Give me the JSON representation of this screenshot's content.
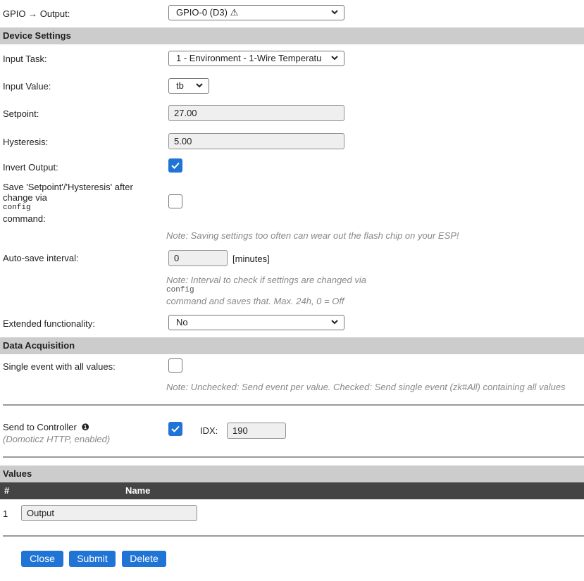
{
  "gpio": {
    "label": "GPIO → Output:",
    "value": "GPIO-0 (D3) ⚠"
  },
  "device_settings": {
    "header": "Device Settings",
    "input_task": {
      "label": "Input Task:",
      "value": "1 - Environment - 1-Wire Temperatu"
    },
    "input_value": {
      "label": "Input Value:",
      "value": "tb"
    },
    "setpoint": {
      "label": "Setpoint:",
      "value": "27.00"
    },
    "hysteresis": {
      "label": "Hysteresis:",
      "value": "5.00"
    },
    "invert_output": {
      "label": "Invert Output:",
      "checked": true
    },
    "save_after_change": {
      "label_line1": "Save 'Setpoint'/'Hysteresis' after",
      "label_line2": "change via",
      "label_code": "config",
      "label_line3": "command:",
      "checked": false,
      "note": "Note: Saving settings too often can wear out the flash chip on your ESP!"
    },
    "auto_save": {
      "label": "Auto-save interval:",
      "value": "0",
      "unit": "[minutes]",
      "note_line1": "Note: Interval to check if settings are changed via",
      "note_code": "config",
      "note_line2": "command and saves that. Max. 24h, 0 = Off"
    },
    "extended": {
      "label": "Extended functionality:",
      "value": "No"
    }
  },
  "data_acquisition": {
    "header": "Data Acquisition",
    "single_event": {
      "label": "Single event with all values:",
      "checked": false,
      "note": "Note: Unchecked: Send event per value. Checked: Send single event (zk#All) containing all values"
    },
    "send_to_controller": {
      "label": "Send to Controller",
      "info_glyph": "❶",
      "sublabel": "(Domoticz HTTP, enabled)",
      "checked": true,
      "idx_label": "IDX:",
      "idx_value": "190"
    }
  },
  "values": {
    "header": "Values",
    "col_num": "#",
    "col_name": "Name",
    "rows": [
      {
        "num": "1",
        "name": "Output"
      }
    ]
  },
  "buttons": {
    "close": "Close",
    "submit": "Submit",
    "delete": "Delete"
  },
  "colors": {
    "accent": "#1f74d5",
    "section_bg": "#cccccc",
    "table_header_bg": "#444444"
  }
}
